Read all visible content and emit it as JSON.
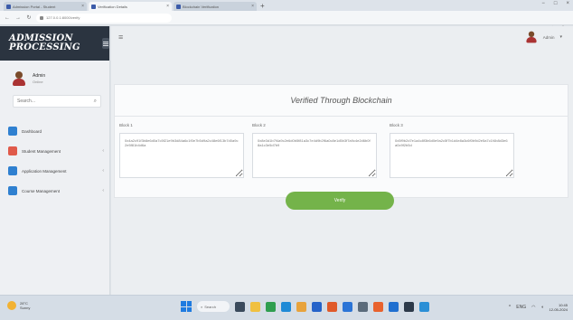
{
  "browser": {
    "tabs": [
      {
        "title": "Admission Portal - Student",
        "active": false
      },
      {
        "title": "Verification Details",
        "active": true
      },
      {
        "title": "Blockchain Verification",
        "active": false
      }
    ],
    "new_tab": "+",
    "window_controls": [
      "−",
      "□",
      "×"
    ],
    "url": "127.0.0.1:8000/verify",
    "nav": [
      "←",
      "→",
      "↻"
    ],
    "tools": [
      "☆",
      "⋮"
    ]
  },
  "sidebar": {
    "brand": "ADMISSION PROCESSING",
    "user": {
      "name": "Admin",
      "status": "Online"
    },
    "search": {
      "placeholder": "Search..."
    },
    "items": [
      {
        "label": "Dashboard",
        "color": "#2f80d0"
      },
      {
        "label": "Student Management",
        "color": "#e05a4a"
      },
      {
        "label": "Application Management",
        "color": "#2f80d0"
      },
      {
        "label": "Course Management",
        "color": "#2f80d0"
      }
    ]
  },
  "header": {
    "menu_icon": "≡",
    "account_name": "Admin",
    "caret": "▾"
  },
  "verify": {
    "title": "Verified Through Blockchain",
    "blocks": [
      {
        "label": "Block 1",
        "hash": "0x4a2c91f3b8e6d0a7c5f21e9b3d84a6c1f0e7b5d9a2c48e6f13b7d0a9c2e5f81b4d6a"
      },
      {
        "label": "Block 2",
        "hash": "0x8e3d1b7f4a9c2e6d0b5f81a3c7e4d9b2f6a0c8e1d5b3f7a9c4e2d6b0f8a1c3e5d7b9"
      },
      {
        "label": "Block 3",
        "hash": "0x5f9b2d7e1a4c8f3b6d0e9a2c5f7b1d4e8a3c6f0b9d2e5a7c1f4b8d3e6a0c9f2b5d"
      }
    ],
    "button_label": "Verify"
  },
  "taskbar": {
    "weather": {
      "temp": "28°C",
      "desc": "Sunny"
    },
    "search_label": "Search",
    "clock": {
      "time": "10:45",
      "date": "12-05-2024"
    },
    "tray": [
      "^",
      "ENG"
    ],
    "colors": {
      "accent": "#74b34a",
      "brand_bg": "#2b3440"
    }
  }
}
